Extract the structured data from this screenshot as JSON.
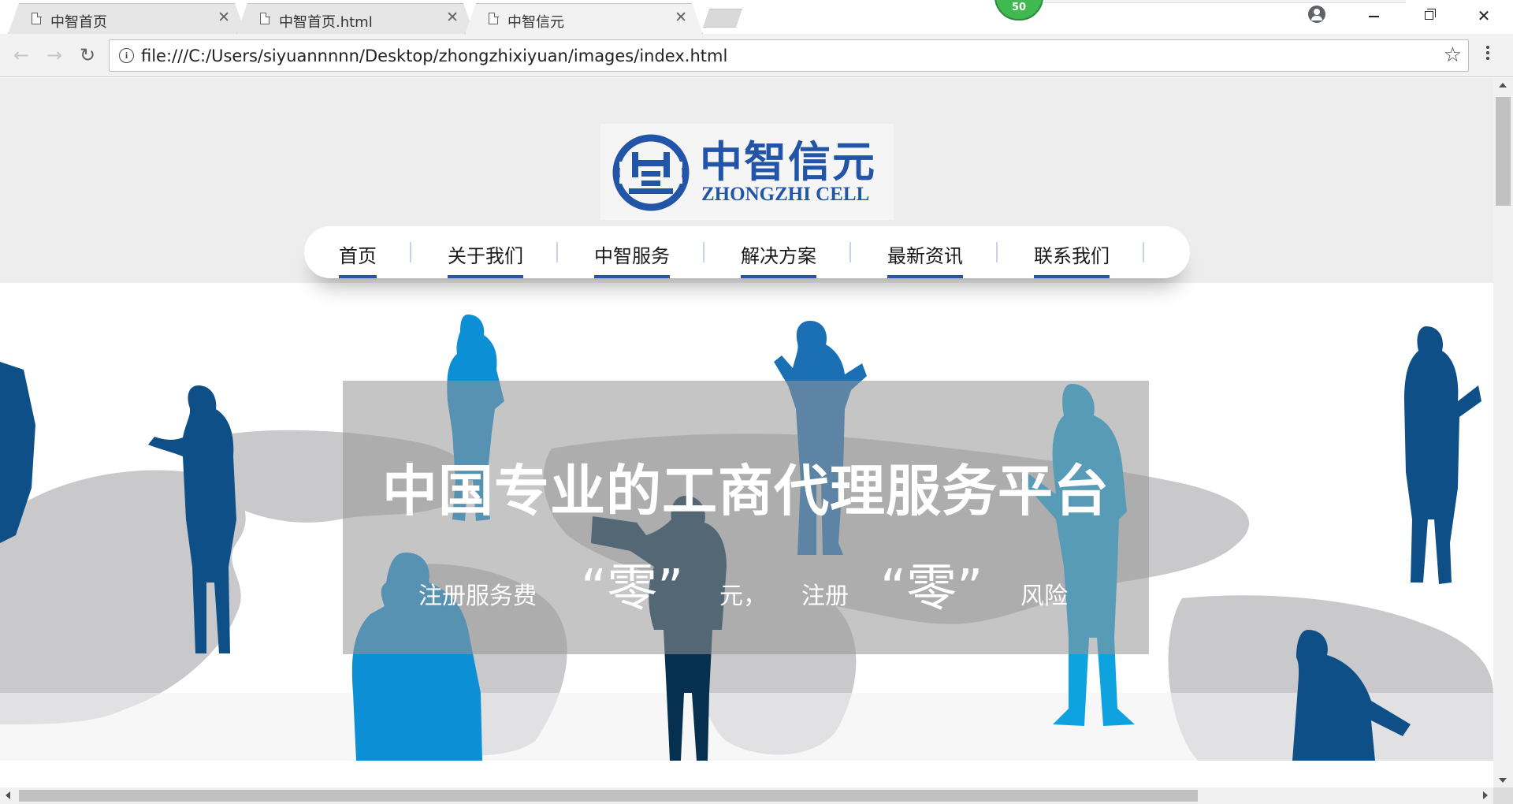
{
  "browser": {
    "tabs": [
      {
        "title": "中智首页",
        "active": false
      },
      {
        "title": "中智首页.html",
        "active": false
      },
      {
        "title": "中智信元",
        "active": true
      }
    ],
    "extension_badge": "50",
    "address": "file:///C:/Users/siyuannnnn/Desktop/zhongzhixiyuan/images/index.html",
    "icons": {
      "back": "back-arrow-icon",
      "forward": "forward-arrow-icon",
      "reload": "reload-icon",
      "info": "info-icon",
      "bookmark": "star-icon",
      "menu": "three-dots-menu-icon",
      "account": "account-icon"
    }
  },
  "site": {
    "logo": {
      "chinese": "中智信元",
      "english": "ZHONGZHI CELL",
      "color": "#2255a8"
    },
    "nav": [
      {
        "label": "首页"
      },
      {
        "label": "关于我们"
      },
      {
        "label": "中智服务"
      },
      {
        "label": "解决方案"
      },
      {
        "label": "最新资讯"
      },
      {
        "label": "联系我们"
      }
    ],
    "accent_color": "#2a54a6",
    "hero": {
      "headline": "中国专业的工商代理服务平台",
      "sub1": "注册服务费",
      "zero1": "“零”",
      "sub2": "元，",
      "sub3": "注册",
      "zero2": "“零”",
      "sub4": "风险"
    }
  }
}
